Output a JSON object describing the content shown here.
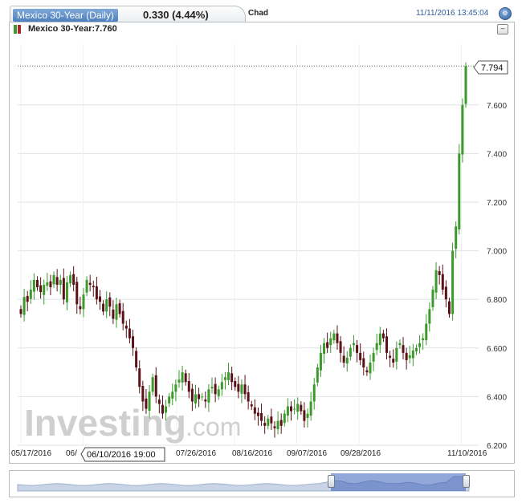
{
  "header": {
    "tab_title": "Mexico 30-Year (Daily)",
    "change": "0.330 (4.44%)",
    "country": "Chad",
    "timestamp": "11/11/2016 13:45:04"
  },
  "legend": {
    "text": "Mexico 30-Year:7.760"
  },
  "tooltip": {
    "date": "06/10/2016 19:00"
  },
  "watermark": {
    "brand": "Investing",
    "suffix": ".com"
  },
  "icons": {
    "settings": "gear-icon",
    "minimize": "minimize-icon",
    "legend": "candle-legend-icon"
  },
  "colors": {
    "up": "#3c9a2c",
    "down": "#5a1218",
    "accent": "#2d5d9f"
  },
  "chart_data": {
    "type": "candlestick",
    "title": "Mexico 30-Year (Daily)",
    "xlabel": "",
    "ylabel": "",
    "ylim": [
      6.2,
      7.85
    ],
    "grid": true,
    "y_ticks": [
      "7.600",
      "7.400",
      "7.200",
      "7.000",
      "6.800",
      "6.600",
      "6.400",
      "6.200"
    ],
    "x_ticks": [
      "05/17/2016",
      "06/",
      "07/26/2016",
      "08/16/2016",
      "09/07/2016",
      "09/28/2016",
      "11/10/2016"
    ],
    "last_price_label": "7.794",
    "current_value": 7.76,
    "values": [
      6.74,
      6.81,
      6.79,
      6.84,
      6.88,
      6.85,
      6.83,
      6.86,
      6.87,
      6.85,
      6.9,
      6.86,
      6.88,
      6.8,
      6.87,
      6.9,
      6.86,
      6.78,
      6.76,
      6.82,
      6.88,
      6.86,
      6.85,
      6.8,
      6.79,
      6.75,
      6.8,
      6.77,
      6.72,
      6.78,
      6.74,
      6.7,
      6.68,
      6.64,
      6.6,
      6.52,
      6.44,
      6.38,
      6.35,
      6.42,
      6.48,
      6.4,
      6.37,
      6.33,
      6.36,
      6.4,
      6.42,
      6.45,
      6.47,
      6.5,
      6.46,
      6.42,
      6.38,
      6.41,
      6.39,
      6.4,
      6.38,
      6.43,
      6.44,
      6.41,
      6.43,
      6.46,
      6.48,
      6.5,
      6.46,
      6.44,
      6.42,
      6.45,
      6.41,
      6.38,
      6.36,
      6.33,
      6.32,
      6.3,
      6.28,
      6.31,
      6.29,
      6.27,
      6.3,
      6.28,
      6.33,
      6.36,
      6.34,
      6.35,
      6.37,
      6.34,
      6.3,
      6.33,
      6.38,
      6.45,
      6.52,
      6.58,
      6.62,
      6.6,
      6.64,
      6.66,
      6.62,
      6.58,
      6.54,
      6.56,
      6.6,
      6.62,
      6.58,
      6.55,
      6.52,
      6.5,
      6.54,
      6.58,
      6.62,
      6.66,
      6.64,
      6.58,
      6.56,
      6.54,
      6.6,
      6.62,
      6.58,
      6.55,
      6.57,
      6.59,
      6.6,
      6.62,
      6.64,
      6.7,
      6.76,
      6.84,
      6.92,
      6.9,
      6.84,
      6.8,
      6.74,
      7.0,
      7.1,
      7.4,
      7.6,
      7.76
    ]
  }
}
